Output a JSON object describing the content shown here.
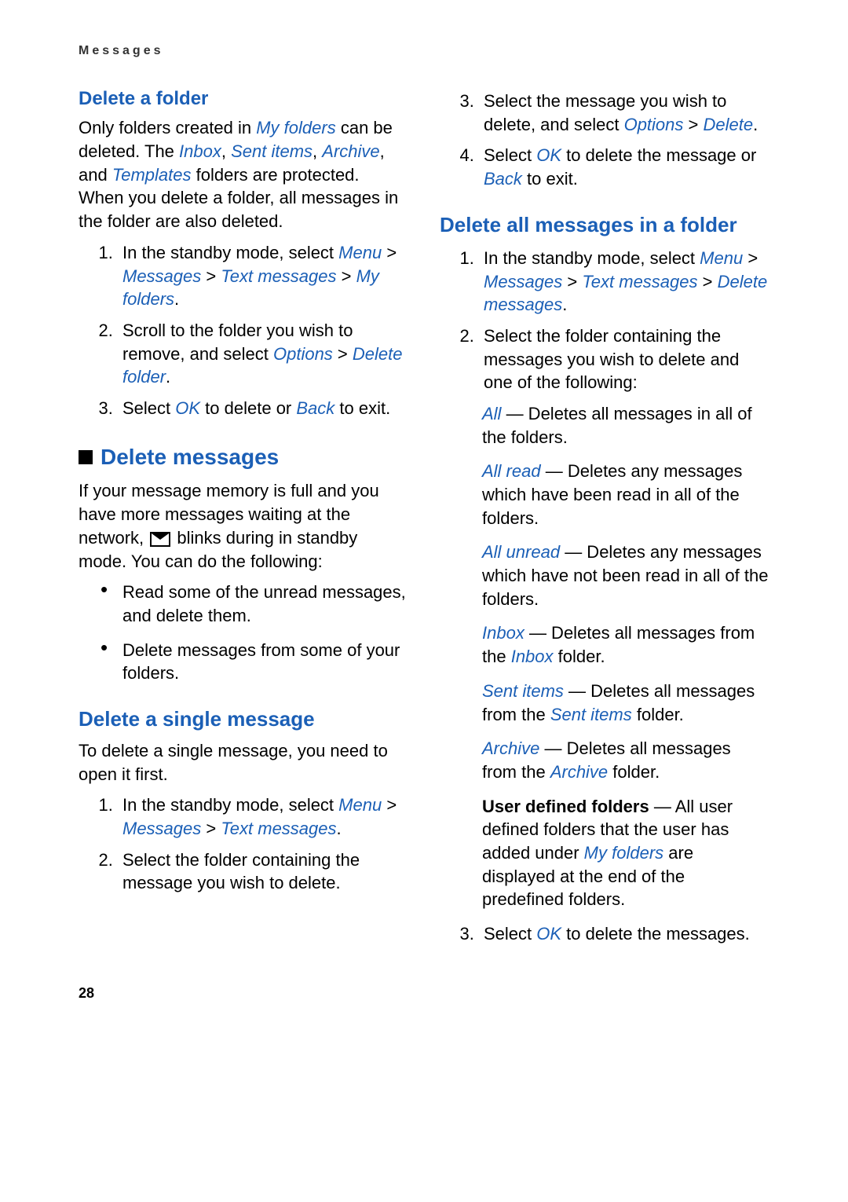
{
  "header": "Messages",
  "page_number": "28",
  "left": {
    "delete_folder": {
      "title": "Delete a folder",
      "p1a": "Only folders created in ",
      "p1b": " can be deleted. The ",
      "p1c": ", and ",
      "p1d": " folders are protected. When you delete a folder, all messages in the folder are also deleted.",
      "my_folders": "My folders",
      "inbox": "Inbox",
      "sent_items": "Sent items",
      "archive": "Archive",
      "templates": "Templates",
      "ol1_a": "In the standby mode, select ",
      "menu": "Menu",
      "messages": "Messages",
      "text_messages": "Text messages",
      "my_folders2": "My folders",
      "ol2_a": "Scroll to the folder you wish to remove, and select ",
      "options": "Options",
      "delete_folder_item": "Delete folder",
      "ol3_a": "Select ",
      "ok": "OK",
      "ol3_b": " to delete or ",
      "back": "Back",
      "ol3_c": " to exit."
    },
    "delete_messages": {
      "title": "Delete messages",
      "p1a": "If your message memory is full and you have more messages waiting at the network, ",
      "p1b": " blinks during in standby mode. You can do the following:",
      "b1": "Read some of the unread messages, and delete them.",
      "b2": "Delete messages from some of your folders."
    },
    "delete_single": {
      "title": "Delete a single message",
      "p1": "To delete a single message, you need to open it first.",
      "ol1_a": "In the standby mode, select ",
      "menu": "Menu",
      "messages": "Messages",
      "text_messages": "Text messages",
      "ol2": "Select the folder containing the message you wish to delete."
    }
  },
  "right": {
    "cont": {
      "ol3_a": "Select the message you wish to delete, and select ",
      "options": "Options",
      "delete": "Delete",
      "ol4_a": "Select ",
      "ok": "OK",
      "ol4_b": " to delete the message or ",
      "back": "Back",
      "ol4_c": " to exit."
    },
    "delete_all": {
      "title": "Delete all messages in a folder",
      "ol1_a": "In the standby mode, select ",
      "menu": "Menu",
      "messages": "Messages",
      "text_messages": "Text messages",
      "delete_messages": "Delete messages",
      "ol2": "Select the folder containing the messages you wish to delete and one of the following:",
      "all": "All",
      "all_t": " — Deletes all messages in all of the folders.",
      "all_read": "All read",
      "all_read_t": " — Deletes any messages which have been read in all of the folders.",
      "all_unread": "All unread",
      "all_unread_t": " — Deletes any messages which have not been read in all of the folders.",
      "inbox": "Inbox",
      "inbox_t1": " — Deletes all messages from the ",
      "inbox2": "Inbox",
      "inbox_t2": " folder.",
      "sent": "Sent items",
      "sent_t1": " — Deletes all messages from the ",
      "sent2": "Sent items",
      "sent_t2": " folder.",
      "archive": "Archive",
      "archive_t1": " — Deletes all messages from the ",
      "archive2": "Archive",
      "archive_t2": " folder.",
      "udf": "User defined folders",
      "udf_t1": " — All user defined folders that the user has added under ",
      "my_folders": "My folders",
      "udf_t2": " are displayed at the end of the predefined folders.",
      "ol3_a": "Select ",
      "ok": "OK",
      "ol3_b": " to delete the messages."
    }
  },
  "sep": {
    "gt": " > ",
    "comma": ", ",
    "period": "."
  }
}
